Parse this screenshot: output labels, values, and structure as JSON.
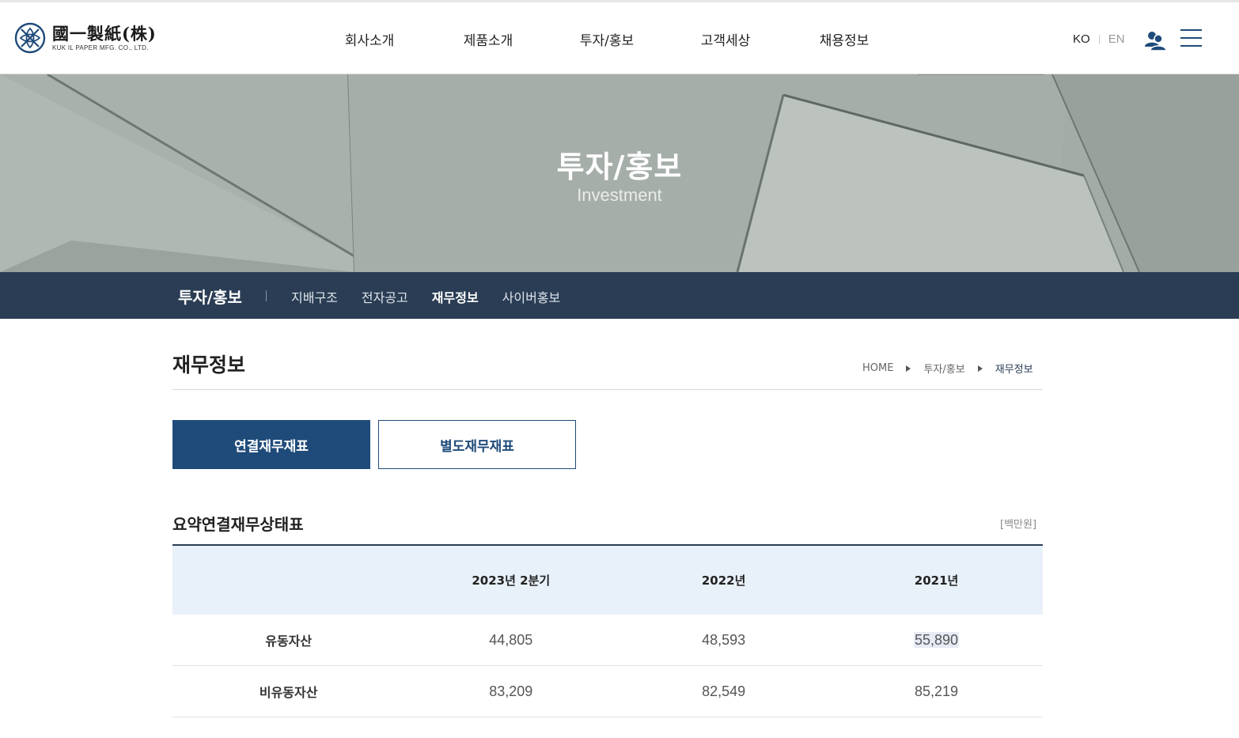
{
  "logo": {
    "main": "國一製紙(株)",
    "sub": "KUK IL PAPER MFG. CO., LTD."
  },
  "gnb": [
    "회사소개",
    "제품소개",
    "투자/홍보",
    "고객세상",
    "채용정보"
  ],
  "lang": {
    "ko": "KO",
    "en": "EN"
  },
  "hero": {
    "title": "투자/홍보",
    "subtitle": "Investment"
  },
  "subnav": {
    "section": "투자/홍보",
    "items": [
      "지배구조",
      "전자공고",
      "재무정보",
      "사이버홍보"
    ],
    "active": "재무정보"
  },
  "page": {
    "title": "재무정보",
    "breadcrumb": [
      "HOME",
      "투자/홍보",
      "재무정보"
    ]
  },
  "tabs": [
    "연결재무재표",
    "별도재무재표"
  ],
  "table": {
    "title": "요약연결재무상태표",
    "unit": "[백만원]",
    "headers": [
      "",
      "2023년 2분기",
      "2022년",
      "2021년"
    ],
    "rows": [
      {
        "label": "유동자산",
        "values": [
          "44,805",
          "48,593",
          "55,890"
        ]
      },
      {
        "label": "비유동자산",
        "values": [
          "83,209",
          "82,549",
          "85,219"
        ]
      }
    ]
  },
  "colors": {
    "brand": "#1f4b7a",
    "subnav": "#2a3d54",
    "table_header": "#e8f0f9"
  }
}
